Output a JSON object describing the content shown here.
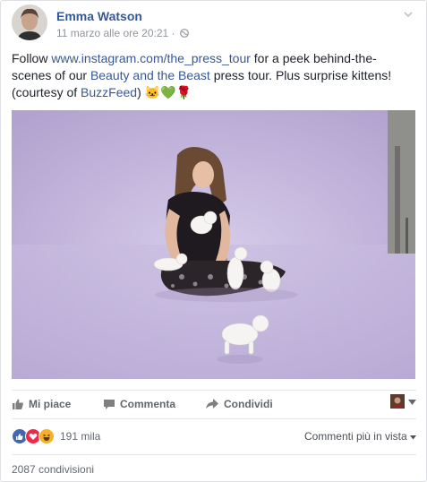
{
  "post": {
    "author": "Emma Watson",
    "timestamp": "11 marzo alle ore 20:21",
    "separator": "·",
    "text": {
      "part1": "Follow ",
      "link1": "www.instagram.com/the_press_tour",
      "part2": " for a peek behind-the-scenes of our ",
      "link2": "Beauty and the Beast",
      "part3": " press tour. Plus surprise kittens! (courtesy of ",
      "link3": "BuzzFeed",
      "part4": ")",
      "emoji": "🐱💚🌹"
    },
    "image_icon": "photo-woman-with-kittens"
  },
  "actions": {
    "like": "Mi piace",
    "comment": "Commenta",
    "share": "Condividi"
  },
  "reactions": {
    "icons": [
      "like-icon",
      "love-icon",
      "haha-icon"
    ],
    "count": "191 mila",
    "sort_label": "Commenti più in vista"
  },
  "shares": {
    "label": "2087 condivisioni"
  },
  "colors": {
    "link": "#365899",
    "like_blue": "#4267b2",
    "love_red": "#f0284a",
    "haha_yellow": "#f7b125"
  }
}
